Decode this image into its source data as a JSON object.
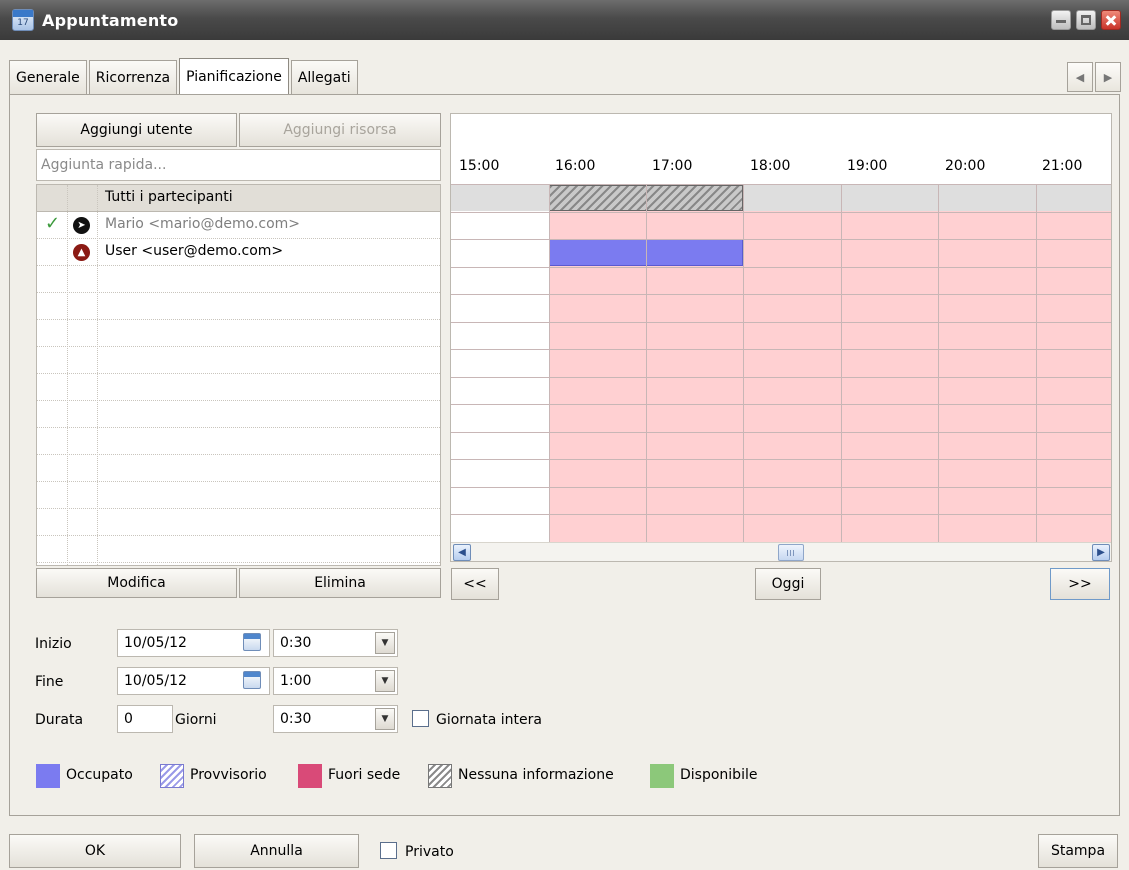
{
  "window": {
    "title": "Appuntamento"
  },
  "tabs": [
    {
      "label": "Generale",
      "active": false
    },
    {
      "label": "Ricorrenza",
      "active": false
    },
    {
      "label": "Pianificazione",
      "active": true
    },
    {
      "label": "Allegati",
      "active": false
    }
  ],
  "attendees": {
    "add_user_label": "Aggiungi utente",
    "add_resource_label": "Aggiungi risorsa",
    "quick_add_placeholder": "Aggiunta rapida...",
    "header_label": "Tutti i partecipanti",
    "rows": [
      {
        "name": "Mario <mario@demo.com>",
        "checked": true,
        "status": "black"
      },
      {
        "name": "User <user@demo.com>",
        "checked": false,
        "status": "red"
      }
    ],
    "edit_label": "Modifica",
    "delete_label": "Elimina"
  },
  "timeline": {
    "hours": [
      "15:00",
      "16:00",
      "17:00",
      "18:00",
      "19:00",
      "20:00",
      "21:00"
    ],
    "prev_label": "<<",
    "today_label": "Oggi",
    "next_label": ">>"
  },
  "form": {
    "start_label": "Inizio",
    "start_date": "10/05/12",
    "start_time": "0:30",
    "end_label": "Fine",
    "end_date": "10/05/12",
    "end_time": "1:00",
    "duration_label": "Durata",
    "duration_days": "0",
    "days_label": "Giorni",
    "duration_time": "0:30",
    "all_day_label": "Giornata intera",
    "all_day_checked": false
  },
  "legend": [
    {
      "label": "Occupato",
      "color": "#7b7bf0",
      "pattern": "solid"
    },
    {
      "label": "Provvisorio",
      "color": "#9a9ae8",
      "pattern": "hatch"
    },
    {
      "label": "Fuori sede",
      "color": "#d94a78",
      "pattern": "solid"
    },
    {
      "label": "Nessuna informazione",
      "color": "#8a8a8a",
      "pattern": "hatch"
    },
    {
      "label": "Disponibile",
      "color": "#8cc87a",
      "pattern": "solid"
    }
  ],
  "footer": {
    "ok_label": "OK",
    "cancel_label": "Annulla",
    "private_label": "Privato",
    "private_checked": false,
    "print_label": "Stampa"
  },
  "colors": {
    "busy": "#7b7bf0",
    "out_of_office": "#ffcfd1",
    "tentative_hatch": "#8a8a8a",
    "header_grey": "#dedede"
  }
}
